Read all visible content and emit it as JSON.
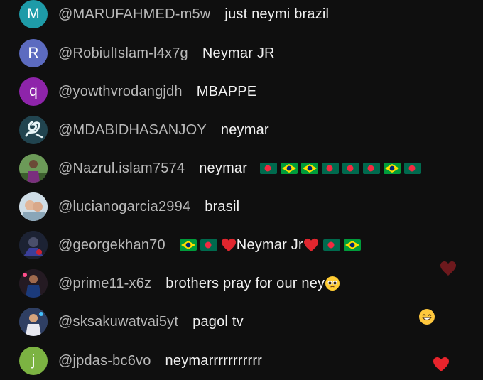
{
  "comments": [
    {
      "avatar_letter": "M",
      "avatar_color": "#1e9ba8",
      "handle": "@MARUFAHMED-m5w",
      "message": "just neymi brazil"
    },
    {
      "avatar_letter": "R",
      "avatar_color": "#5c6bc0",
      "handle": "@RobiulIslam-l4x7g",
      "message": "Neymar JR"
    },
    {
      "avatar_letter": "q",
      "avatar_color": "#8e24aa",
      "handle": "@yowthvrodangjdh",
      "message": "MBAPPE"
    },
    {
      "avatar_icon": "dragon-avatar-icon",
      "handle": "@MDABIDHASANJOY",
      "message": "neymar"
    },
    {
      "avatar_icon": "photo-avatar-icon",
      "handle": "@Nazrul.islam7574",
      "message": "neymar"
    },
    {
      "avatar_icon": "photo-avatar-icon",
      "handle": "@lucianogarcia2994",
      "message": "brasil"
    },
    {
      "avatar_icon": "photo-avatar-icon",
      "handle": "@georgekhan70",
      "message": "Neymar Jr"
    },
    {
      "avatar_icon": "photo-avatar-icon",
      "handle": "@prime11-x6z",
      "message": "brothers pray for our ney"
    },
    {
      "avatar_icon": "photo-avatar-icon",
      "handle": "@sksakuwatvai5yt",
      "message": "pagol tv"
    },
    {
      "avatar_letter": "j",
      "avatar_color": "#7cb342",
      "handle": "@jpdas-bc6vo",
      "message": "neymarrrrrrrrrrr"
    }
  ],
  "colors": {
    "background": "#0f0f0f",
    "handle": "#b9b9b9",
    "text": "#f1f1f1",
    "bangladesh_green": "#006a4e",
    "bangladesh_red": "#f42a41",
    "brazil_green": "#009c3b",
    "brazil_yellow": "#ffdf00",
    "brazil_blue": "#002776",
    "heart_red": "#e0262e"
  }
}
